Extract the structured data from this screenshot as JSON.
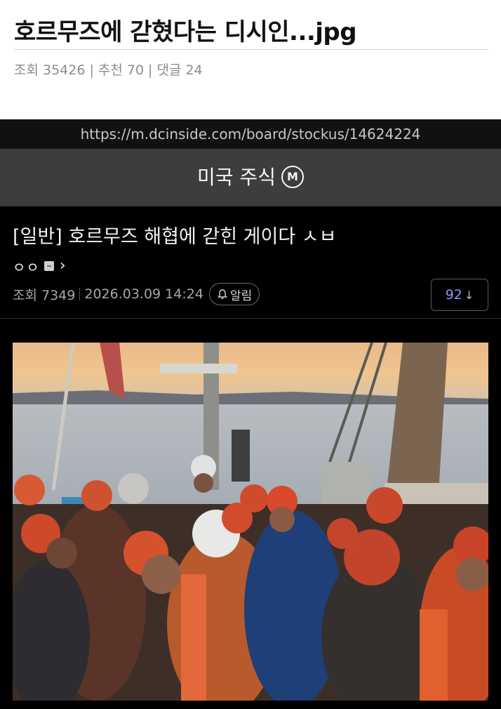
{
  "post": {
    "title": "호르무즈에 갇혔다는 디시인...jpg",
    "views_label": "조회 35426",
    "recommend_label": "추천 70",
    "comments_label": "댓글 24",
    "separator": "|"
  },
  "screenshot": {
    "url": "https://m.dcinside.com/board/stockus/14624224",
    "gallery_name": "미국 주식",
    "gallery_badge": "M",
    "article_title": "[일반] 호르무즈 해협에 갇힌 게이다 ㅅㅂ",
    "author": "ㅇㅇ",
    "author_chevron": "›",
    "views_label": "조회 7349",
    "date": "2026.03.09 14:24",
    "alarm_label": "알림",
    "reply_count": "92",
    "reply_arrow": "↓"
  },
  "colors": {
    "page_bg": "#ffffff",
    "screenshot_bg": "#000000",
    "gallery_bar": "#3d3d3d",
    "reply_count_text": "#8e96ff"
  }
}
